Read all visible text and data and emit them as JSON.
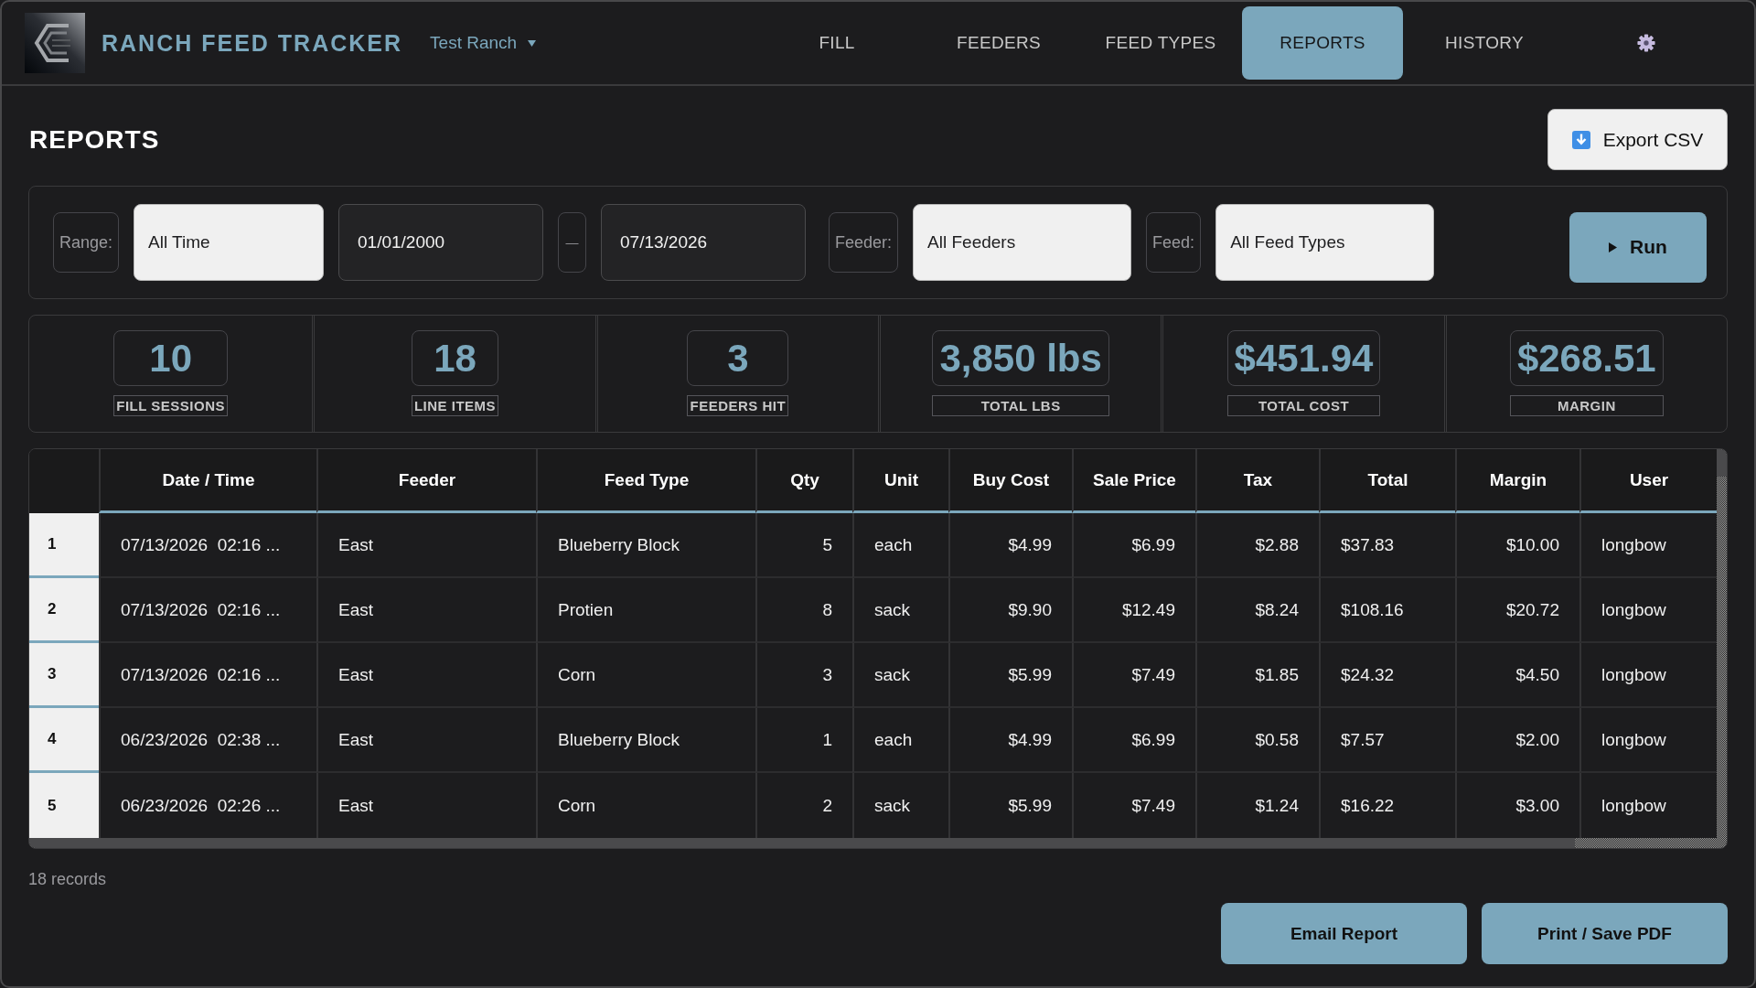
{
  "header": {
    "app_title": "RANCH FEED TRACKER",
    "ranch": "Test Ranch"
  },
  "nav": [
    {
      "label": "FILL",
      "selected": false
    },
    {
      "label": "FEEDERS",
      "selected": false
    },
    {
      "label": "FEED TYPES",
      "selected": false
    },
    {
      "label": "REPORTS",
      "selected": true
    },
    {
      "label": "HISTORY",
      "selected": false
    }
  ],
  "page": {
    "title": "REPORTS",
    "export_button": "Export CSV"
  },
  "filters": {
    "range_label": "Range:",
    "range": "All Time",
    "date_from": "01/01/2000",
    "date_separator": "—",
    "date_to": "07/13/2026",
    "feeder_label": "Feeder:",
    "feeder": "All Feeders",
    "feed_label": "Feed:",
    "feed": "All Feed Types",
    "run_button": "Run"
  },
  "stats": [
    {
      "value": "10",
      "label": "FILL SESSIONS"
    },
    {
      "value": "18",
      "label": "LINE ITEMS"
    },
    {
      "value": "3",
      "label": "FEEDERS HIT"
    },
    {
      "value": "3,850 lbs",
      "label": "TOTAL LBS"
    },
    {
      "value": "$451.94",
      "label": "TOTAL COST"
    },
    {
      "value": "$268.51",
      "label": "MARGIN"
    }
  ],
  "table": {
    "columns": [
      "Date / Time",
      "Feeder",
      "Feed Type",
      "Qty",
      "Unit",
      "Buy Cost",
      "Sale Price",
      "Tax",
      "Total",
      "Margin",
      "User"
    ],
    "rows": [
      {
        "number": "1",
        "cells": [
          "07/13/2026  02:16 ...",
          "East",
          "Blueberry Block",
          "5",
          "each",
          "$4.99",
          "$6.99",
          "$2.88",
          "$37.83",
          "$10.00",
          "longbow"
        ]
      },
      {
        "number": "2",
        "cells": [
          "07/13/2026  02:16 ...",
          "East",
          "Protien",
          "8",
          "sack",
          "$9.90",
          "$12.49",
          "$8.24",
          "$108.16",
          "$20.72",
          "longbow"
        ]
      },
      {
        "number": "3",
        "cells": [
          "07/13/2026  02:16 ...",
          "East",
          "Corn",
          "3",
          "sack",
          "$5.99",
          "$7.49",
          "$1.85",
          "$24.32",
          "$4.50",
          "longbow"
        ]
      },
      {
        "number": "4",
        "cells": [
          "06/23/2026  02:38 ...",
          "East",
          "Blueberry Block",
          "1",
          "each",
          "$4.99",
          "$6.99",
          "$0.58",
          "$7.57",
          "$2.00",
          "longbow"
        ]
      },
      {
        "number": "5",
        "cells": [
          "06/23/2026  02:26 ...",
          "East",
          "Corn",
          "2",
          "sack",
          "$5.99",
          "$7.49",
          "$1.24",
          "$16.22",
          "$3.00",
          "longbow"
        ]
      }
    ]
  },
  "footer": {
    "records": "18 records",
    "buttons": [
      "Email Report",
      "Print / Save PDF"
    ]
  }
}
